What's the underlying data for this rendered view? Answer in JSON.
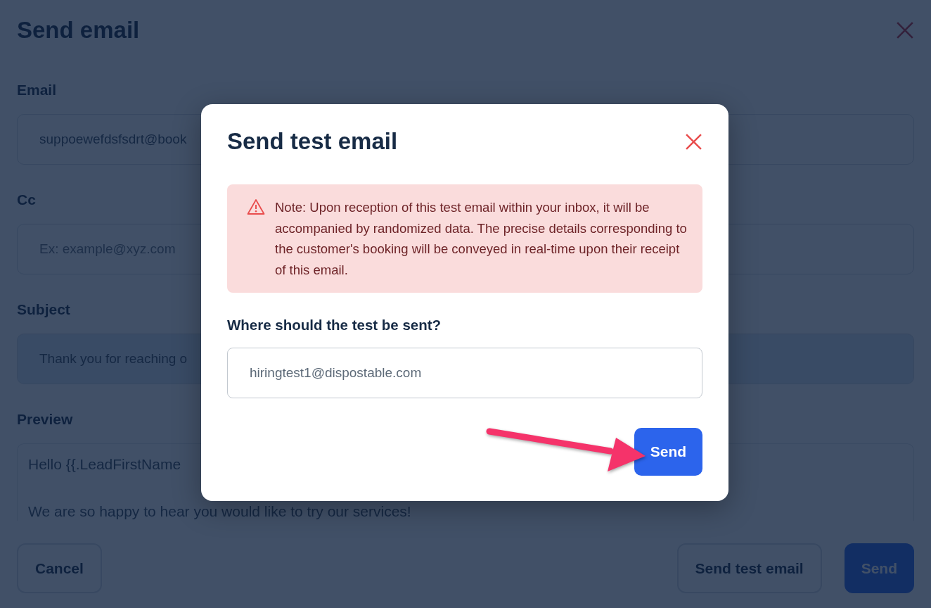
{
  "page": {
    "title": "Send email",
    "fields": [
      {
        "label": "Email",
        "kind": "plain",
        "value": "suppoewefdsfsdrt@book"
      },
      {
        "label": "Cc",
        "kind": "plain",
        "placeholder": "Ex: example@xyz.com"
      },
      {
        "label": "Subject",
        "kind": "filled",
        "value": "Thank you for reaching o"
      }
    ],
    "preview": {
      "label": "Preview",
      "lines": [
        "Hello {{.LeadFirstName",
        "We are so happy to hear you would like to try our services!"
      ]
    },
    "buttons": [
      {
        "label": "Cancel",
        "kind": "outline"
      },
      {
        "label": "Send test email",
        "kind": "outline"
      },
      {
        "label": "Send",
        "kind": "primary"
      }
    ]
  },
  "dialog": {
    "title": "Send test email",
    "note": "Note: Upon reception of this test email within your inbox, it will be accompanied by randomized data. The precise details corresponding to the customer's booking will be conveyed in real-time upon their receipt of this email.",
    "question": "Where should the test be sent?",
    "recipient": {
      "value": "hiringtest1@dispostable.com"
    },
    "send_button": "Send"
  }
}
